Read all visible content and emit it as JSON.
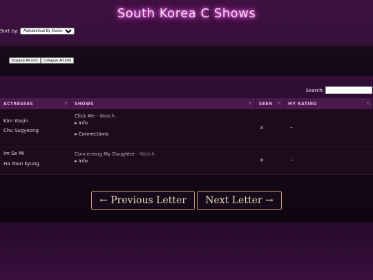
{
  "page": {
    "title": "South Korea C Shows"
  },
  "sort": {
    "label": "Sort by:",
    "selected": "Alphabetical By Shows"
  },
  "controls": {
    "expand_label": "Expand All Info",
    "collapse_label": "Collapse All Info"
  },
  "search": {
    "label": "Search:",
    "value": ""
  },
  "table": {
    "headers": {
      "actresses": "ACTRESSES",
      "shows": "SHOWS",
      "seen": "SEEN",
      "rating": "MY RATING"
    },
    "rows": [
      {
        "actresses": [
          "Kim Yoojin",
          "Chu Sugyeong"
        ],
        "show_title": "Click Me",
        "show_sep": " - ",
        "show_watch": "Watch",
        "toggles": [
          "▸ Info",
          "▸ Connections"
        ],
        "seen_icon": "✖",
        "rating": "–"
      },
      {
        "actresses": [
          "Im Se Mi",
          "Ha Yoon Kyung"
        ],
        "show_title": "Concerning My Daughter",
        "show_sep": " - ",
        "show_watch": "Watch",
        "toggles": [
          "▸ Info"
        ],
        "seen_icon": "✖",
        "rating": "–"
      }
    ]
  },
  "pagination": {
    "prev_label": "← Previous Letter",
    "next_label": "Next Letter →"
  }
}
